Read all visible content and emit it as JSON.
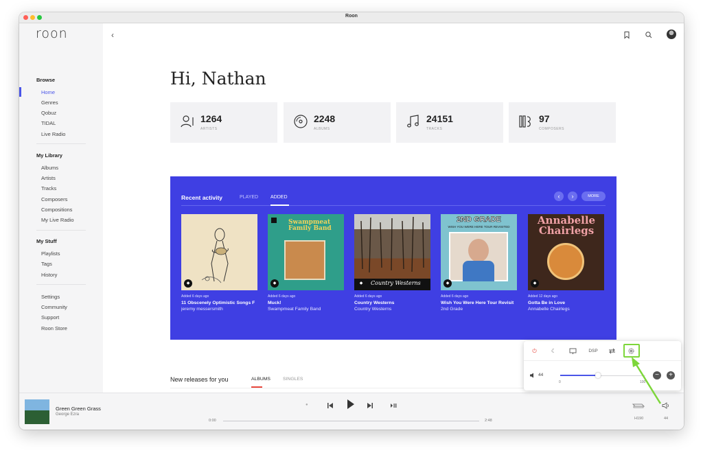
{
  "window": {
    "title": "Roon"
  },
  "sidebar": {
    "logo": "roon",
    "browse": {
      "heading": "Browse",
      "items": [
        "Home",
        "Genres",
        "Qobuz",
        "TIDAL",
        "Live Radio"
      ]
    },
    "library": {
      "heading": "My Library",
      "items": [
        "Albums",
        "Artists",
        "Tracks",
        "Composers",
        "Compositions",
        "My Live Radio"
      ]
    },
    "stuff": {
      "heading": "My Stuff",
      "items": [
        "Playlists",
        "Tags",
        "History"
      ]
    },
    "extra": {
      "items": [
        "Settings",
        "Community",
        "Support",
        "Roon Store"
      ]
    }
  },
  "main": {
    "greeting": "Hi, Nathan",
    "stats": [
      {
        "value": "1264",
        "label": "ARTISTS",
        "icon": "artist-icon"
      },
      {
        "value": "2248",
        "label": "ALBUMS",
        "icon": "album-icon"
      },
      {
        "value": "24151",
        "label": "TRACKS",
        "icon": "track-icon"
      },
      {
        "value": "97",
        "label": "COMPOSERS",
        "icon": "composer-icon"
      }
    ],
    "recent": {
      "title": "Recent activity",
      "tabs": [
        "PLAYED",
        "ADDED"
      ],
      "active_tab": "ADDED",
      "more_label": "MORE",
      "albums": [
        {
          "added": "Added 6 days ago",
          "title": "11 Obscenely Optimistic Songs F",
          "artist": "jeremy messersmith"
        },
        {
          "added": "Added 6 days ago",
          "title": "Muck!",
          "artist": "Swampmeat Family Band",
          "cover_text": "Swampmeat Family Band"
        },
        {
          "added": "Added 6 days ago",
          "title": "Country Westerns",
          "artist": "Country Westerns",
          "cover_text": "Country Westerns"
        },
        {
          "added": "Added 6 days ago",
          "title": "Wish You Were Here Tour Revisit",
          "artist": "2nd Grade",
          "cover_text": "2ND GRADE",
          "cover_subtext": "WISH YOU WERE HERE TOUR REVISITED"
        },
        {
          "added": "Added 12 days ago",
          "title": "Gotta Be in Love",
          "artist": "Annabelle Chairlegs",
          "cover_text": "Annabelle Chairlegs"
        }
      ]
    },
    "new_releases": {
      "title": "New releases for you",
      "tabs": [
        "ALBUMS",
        "SINGLES"
      ],
      "active_tab": "ALBUMS"
    }
  },
  "player": {
    "track_title": "Green Green Grass",
    "track_artist": "George Ezra",
    "time_elapsed": "0:00",
    "time_total": "2:48",
    "progress": 0.0,
    "zone_name": "H190",
    "volume_label": "44"
  },
  "zone_popup": {
    "buttons": [
      "power-icon",
      "moon-icon",
      "display-icon",
      "DSP",
      "transfer-icon",
      "gear-icon"
    ],
    "dsp_label": "DSP",
    "volume": "44",
    "volume_value": 44,
    "volume_min": "0",
    "volume_max": "100"
  },
  "colors": {
    "accent": "#4a55e8",
    "recent_bg": "#3f3fe3",
    "highlight": "#7dd63a",
    "power": "#e8463c"
  }
}
